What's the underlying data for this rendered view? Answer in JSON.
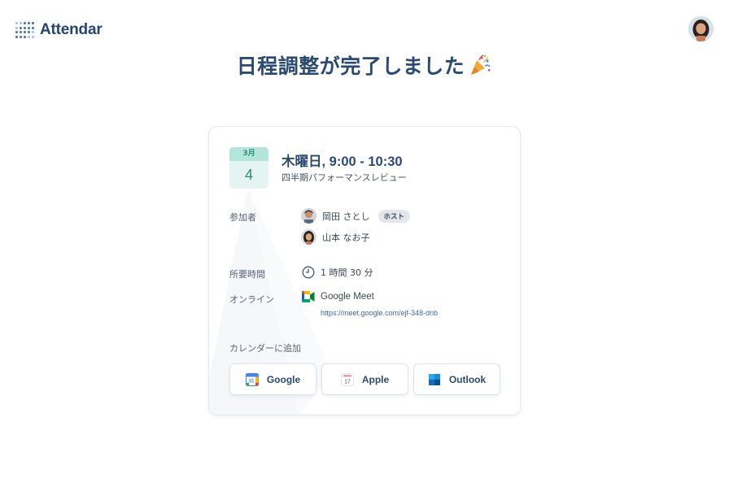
{
  "header": {
    "brand": "Attendar",
    "brand_icon": "attendar-dots-logo",
    "user_avatar": "user-avatar"
  },
  "page": {
    "title": "日程調整が完了しました",
    "title_icon": "party-popper-icon"
  },
  "event": {
    "month": "3月",
    "day": "4",
    "time": "木曜日, 9:00 - 10:30",
    "name": "四半期パフォーマンスレビュー"
  },
  "details": {
    "participants_label": "参加者",
    "participants": [
      {
        "name": "岡田 さとし",
        "badge": "ホスト"
      },
      {
        "name": "山本 なお子"
      }
    ],
    "duration_label": "所要時間",
    "duration": "1 時間 30 分",
    "online_label": "オンライン",
    "meeting_service": "Google Meet",
    "meeting_url": "https://meet.google.com/ejf-348-dnb"
  },
  "add_to_calendar": {
    "label": "カレンダーに追加",
    "buttons": [
      {
        "label": "Google",
        "icon": "google-calendar-icon"
      },
      {
        "label": "Apple",
        "icon": "apple-calendar-icon"
      },
      {
        "label": "Outlook",
        "icon": "outlook-icon"
      }
    ]
  },
  "colors": {
    "brand": "#2b4a72",
    "accent_teal": "#2f8c7c",
    "link": "#3e6aa6"
  }
}
